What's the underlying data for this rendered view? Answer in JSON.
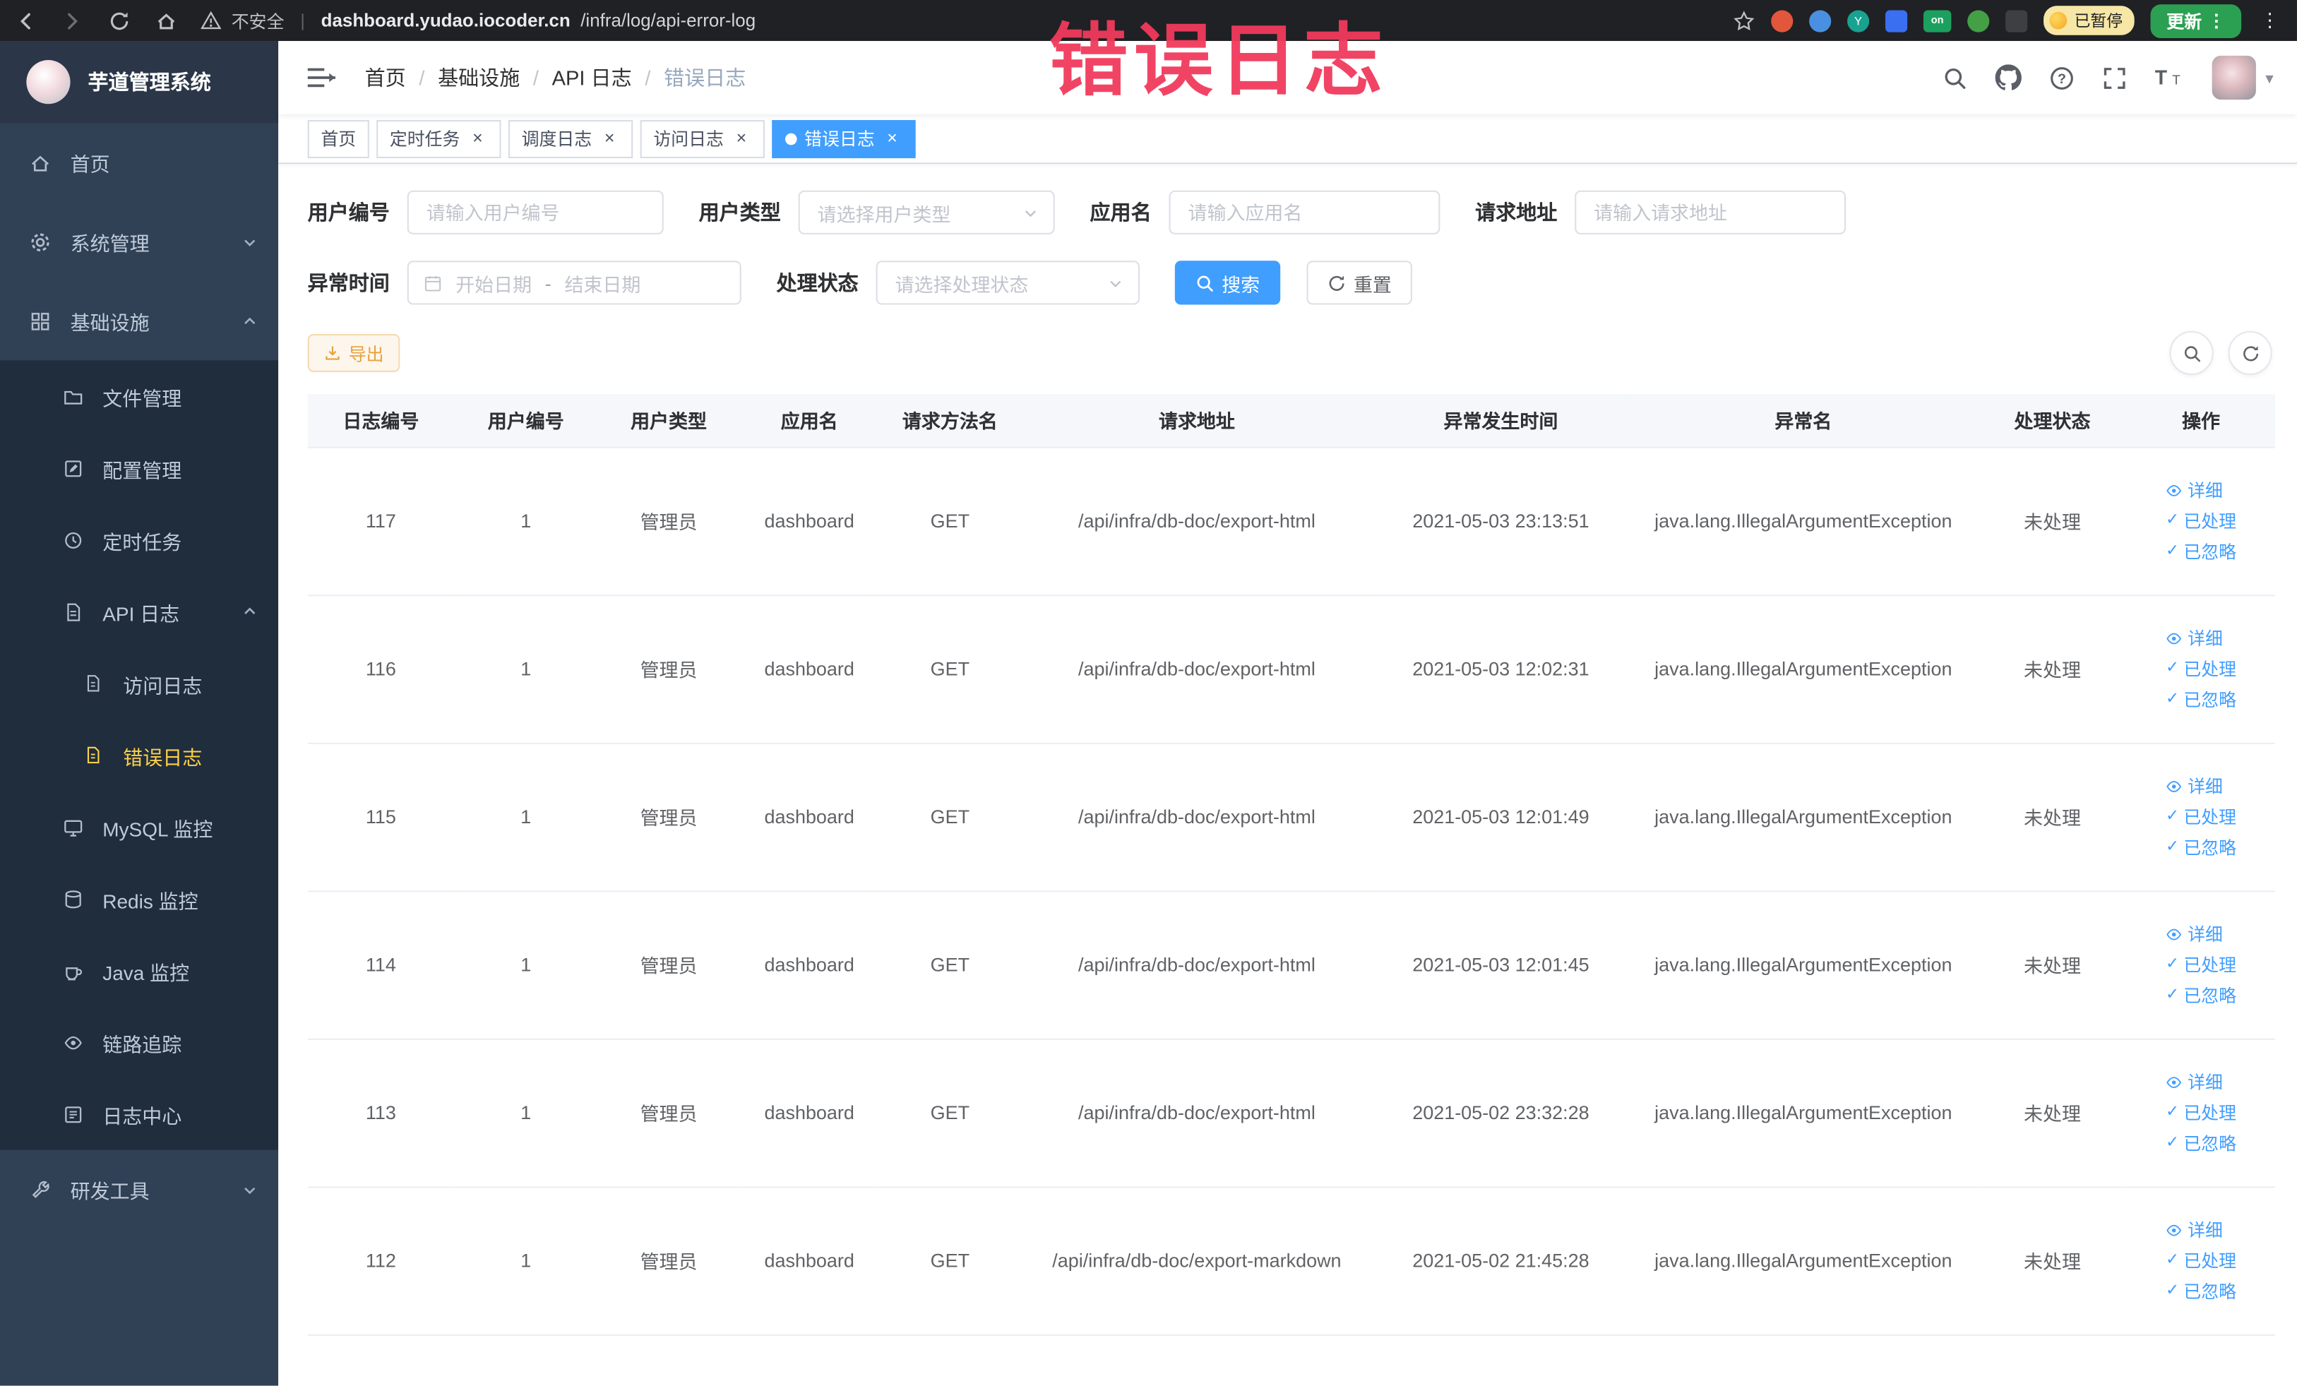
{
  "annotation": {
    "text": "错误日志"
  },
  "glyphs": {
    "close": "×",
    "check": "✓",
    "kebab": "⋮",
    "caret": "▾",
    "separator": "/"
  },
  "browser_chrome": {
    "security_label": "不安全",
    "url_domain": "dashboard.yudao.iocoder.cn",
    "url_path": "/infra/log/api-error-log",
    "extension_badge_on": "on",
    "paused_badge_label": "已暂停",
    "update_button_label": "更新"
  },
  "sidebar": {
    "logo_title": "芋道管理系统",
    "items": [
      {
        "label": "首页"
      },
      {
        "label": "系统管理"
      },
      {
        "label": "基础设施"
      },
      {
        "label": "文件管理"
      },
      {
        "label": "配置管理"
      },
      {
        "label": "定时任务"
      },
      {
        "label": "API 日志"
      },
      {
        "label": "访问日志"
      },
      {
        "label": "错误日志"
      },
      {
        "label": "MySQL 监控"
      },
      {
        "label": "Redis 监控"
      },
      {
        "label": "Java 监控"
      },
      {
        "label": "链路追踪"
      },
      {
        "label": "日志中心"
      },
      {
        "label": "研发工具"
      }
    ]
  },
  "breadcrumb": {
    "items": [
      "首页",
      "基础设施",
      "API 日志",
      "错误日志"
    ]
  },
  "tabs": [
    {
      "label": "首页"
    },
    {
      "label": "定时任务"
    },
    {
      "label": "调度日志"
    },
    {
      "label": "访问日志"
    },
    {
      "label": "错误日志"
    }
  ],
  "filters": {
    "user_id_label": "用户编号",
    "user_id_placeholder": "请输入用户编号",
    "user_type_label": "用户类型",
    "user_type_placeholder": "请选择用户类型",
    "app_name_label": "应用名",
    "app_name_placeholder": "请输入应用名",
    "request_url_label": "请求地址",
    "request_url_placeholder": "请输入请求地址",
    "exception_time_label": "异常时间",
    "date_start_placeholder": "开始日期",
    "date_range_separator": "-",
    "date_end_placeholder": "结束日期",
    "process_status_label": "处理状态",
    "process_status_placeholder": "请选择处理状态",
    "search_button_label": "搜索",
    "reset_button_label": "重置"
  },
  "toolbar": {
    "export_label": "导出"
  },
  "table": {
    "columns": [
      "日志编号",
      "用户编号",
      "用户类型",
      "应用名",
      "请求方法名",
      "请求地址",
      "异常发生时间",
      "异常名",
      "处理状态",
      "操作"
    ],
    "action_labels": {
      "detail": "详细",
      "processed": "已处理",
      "ignored": "已忽略"
    },
    "rows": [
      {
        "log_id": "117",
        "user_id": "1",
        "user_type": "管理员",
        "app_name": "dashboard",
        "method": "GET",
        "url": "/api/infra/db-doc/export-html",
        "time": "2021-05-03 23:13:51",
        "exception": "java.lang.IllegalArgumentException",
        "status": "未处理"
      },
      {
        "log_id": "116",
        "user_id": "1",
        "user_type": "管理员",
        "app_name": "dashboard",
        "method": "GET",
        "url": "/api/infra/db-doc/export-html",
        "time": "2021-05-03 12:02:31",
        "exception": "java.lang.IllegalArgumentException",
        "status": "未处理"
      },
      {
        "log_id": "115",
        "user_id": "1",
        "user_type": "管理员",
        "app_name": "dashboard",
        "method": "GET",
        "url": "/api/infra/db-doc/export-html",
        "time": "2021-05-03 12:01:49",
        "exception": "java.lang.IllegalArgumentException",
        "status": "未处理"
      },
      {
        "log_id": "114",
        "user_id": "1",
        "user_type": "管理员",
        "app_name": "dashboard",
        "method": "GET",
        "url": "/api/infra/db-doc/export-html",
        "time": "2021-05-03 12:01:45",
        "exception": "java.lang.IllegalArgumentException",
        "status": "未处理"
      },
      {
        "log_id": "113",
        "user_id": "1",
        "user_type": "管理员",
        "app_name": "dashboard",
        "method": "GET",
        "url": "/api/infra/db-doc/export-html",
        "time": "2021-05-02 23:32:28",
        "exception": "java.lang.IllegalArgumentException",
        "status": "未处理"
      },
      {
        "log_id": "112",
        "user_id": "1",
        "user_type": "管理员",
        "app_name": "dashboard",
        "method": "GET",
        "url": "/api/infra/db-doc/export-markdown",
        "time": "2021-05-02 21:45:28",
        "exception": "java.lang.IllegalArgumentException",
        "status": "未处理"
      }
    ]
  }
}
